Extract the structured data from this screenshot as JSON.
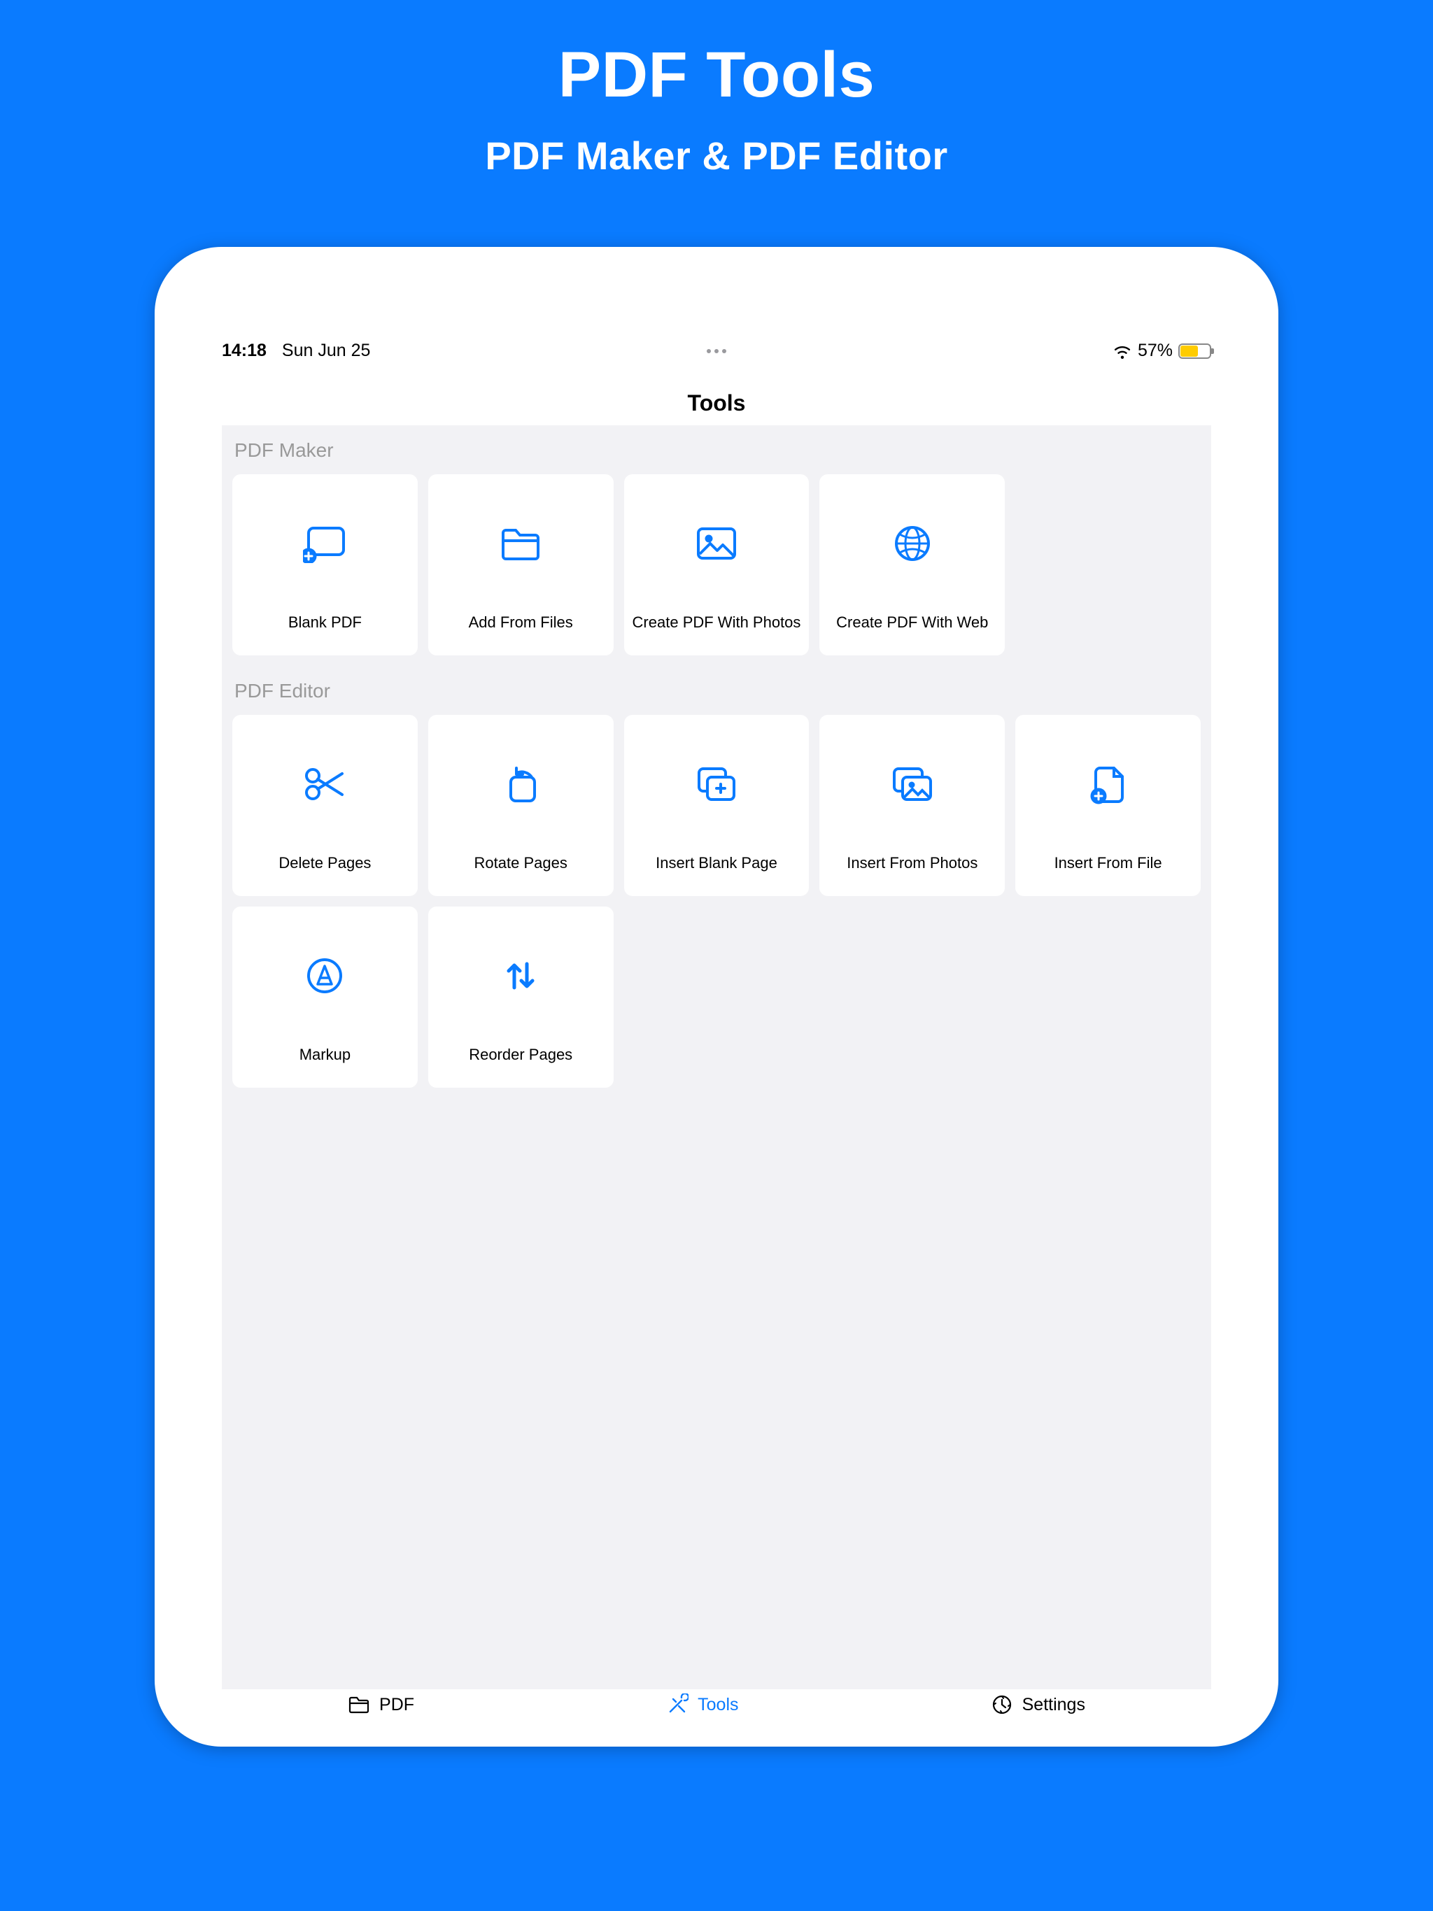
{
  "marketing": {
    "title": "PDF Tools",
    "subtitle": "PDF Maker & PDF Editor"
  },
  "statusbar": {
    "time": "14:18",
    "date": "Sun Jun 25",
    "battery_pct": "57%"
  },
  "navbar": {
    "title": "Tools"
  },
  "sections": [
    {
      "header": "PDF Maker",
      "tiles": [
        {
          "label": "Blank PDF"
        },
        {
          "label": "Add From Files"
        },
        {
          "label": "Create PDF With Photos"
        },
        {
          "label": "Create PDF With Web"
        }
      ]
    },
    {
      "header": "PDF Editor",
      "tiles": [
        {
          "label": "Delete Pages"
        },
        {
          "label": "Rotate Pages"
        },
        {
          "label": "Insert Blank Page"
        },
        {
          "label": "Insert From Photos"
        },
        {
          "label": "Insert From File"
        },
        {
          "label": "Markup"
        },
        {
          "label": "Reorder Pages"
        }
      ]
    }
  ],
  "tabbar": {
    "pdf": "PDF",
    "tools": "Tools",
    "settings": "Settings"
  }
}
